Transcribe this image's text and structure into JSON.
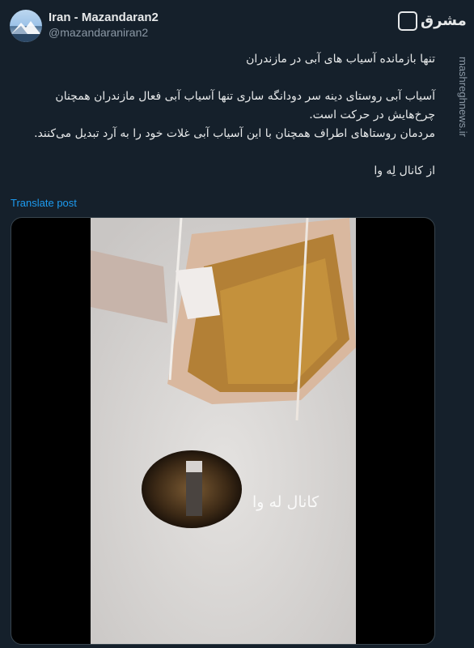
{
  "author": {
    "display_name": "Iran - Mazandaran2",
    "handle": "@mazandaraniran2"
  },
  "branding": {
    "logo_text": "مشرق",
    "side_watermark": "mashreghnews.ir"
  },
  "tweet": {
    "line1": "تنها بازمانده آسیاب های آبی در مازندران",
    "line2": "آسیاب آبی روستای دینه سر دودانگه ساری تنها آسیاب آبی فعال مازندران همچنان چرخ‌هایش در حرکت است.",
    "line3": "مردمان روستاهای اطراف همچنان با این آسیاب آبی غلات خود را به آرد تبدیل می‌کنند.",
    "line4": "از کانال  لِه وا"
  },
  "translate_label": "Translate post",
  "media": {
    "video_caption": "کانال له وا"
  },
  "colors": {
    "background": "#15202b",
    "text": "#e7e9ea",
    "secondary": "#8b98a5",
    "link": "#1d9bf0"
  }
}
